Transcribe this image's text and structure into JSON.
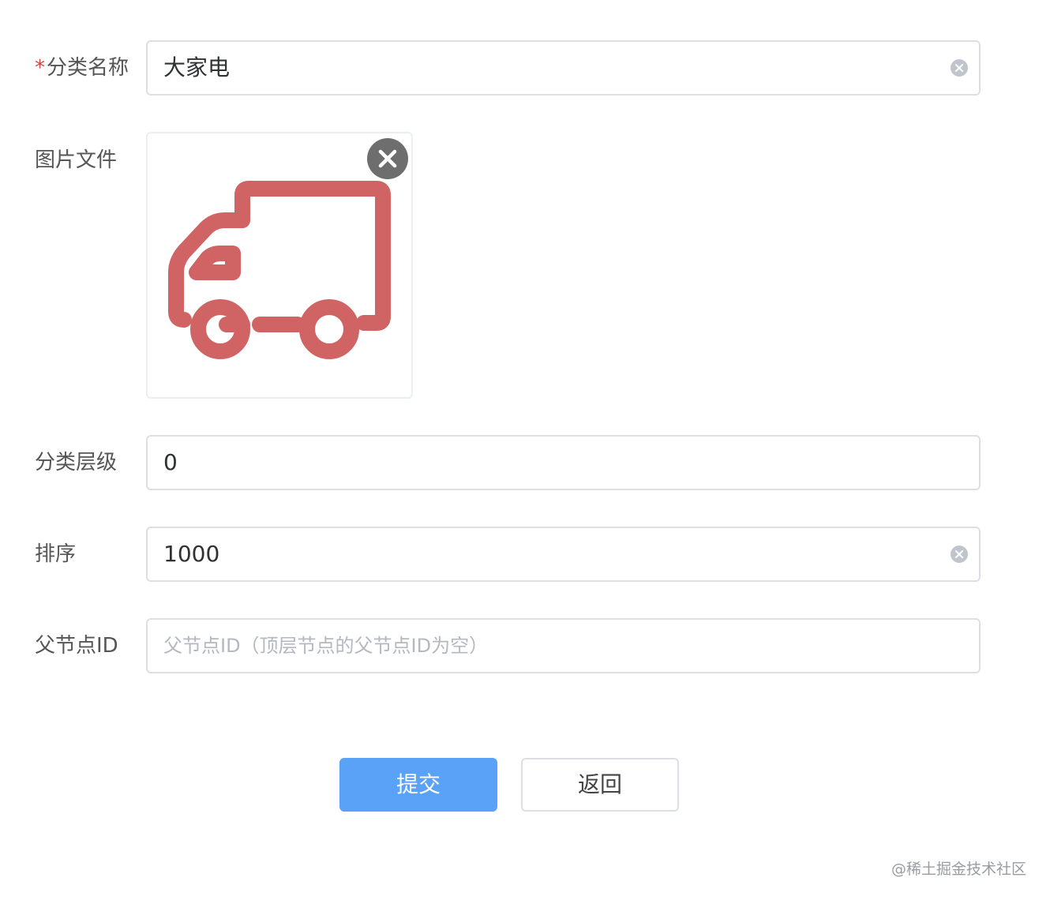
{
  "form": {
    "category_name": {
      "required_mark": "*",
      "label": "分类名称",
      "value": "大家电"
    },
    "image_file": {
      "label": "图片文件",
      "image_icon": "truck-icon",
      "image_color": "#d06464"
    },
    "category_level": {
      "label": "分类层级",
      "value": "0"
    },
    "sort_order": {
      "label": "排序",
      "value": "1000"
    },
    "parent_id": {
      "label": "父节点ID",
      "placeholder": "父节点ID（顶层节点的父节点ID为空）"
    }
  },
  "actions": {
    "submit_label": "提交",
    "back_label": "返回"
  },
  "watermark": "@稀土掘金技术社区",
  "colors": {
    "primary": "#5aa2f7",
    "required": "#e0413a",
    "border": "#dcdfe6"
  }
}
